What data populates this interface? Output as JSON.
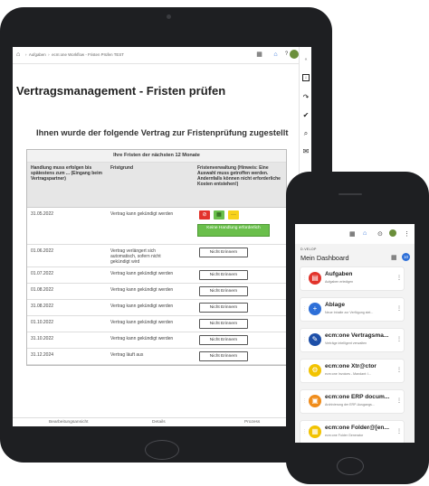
{
  "tablet": {
    "breadcrumb": [
      "Aufgaben",
      "ecm:one Workflow - Fristen Prüfen TEST"
    ],
    "title": "Vertragsmanagement - Fristen prüfen",
    "subtitle": "Ihnen wurde der folgende Vertrag zur Fristenprüfung zugestellt",
    "table": {
      "title": "Ihre Fristen der nächsten 12 Monate",
      "headers": [
        "Handlung muss erfolgen bis spätestens zum ... (Eingang beim Vertragspartner)",
        "Fristgrund",
        "Fristenverwaltung (Hinweis: Eine Auswahl muss getroffen werden. Andernfalls können nicht erforderliche Kosten entstehen!)"
      ],
      "first_row": {
        "date": "31.05.2022",
        "reason": "Vertrag kann gekündigt werden",
        "action_label": "Keine Handlung erforderlich"
      },
      "rows": [
        {
          "date": "01.06.2022",
          "reason": "Vertrag verlängert sich automatisch, sofern nicht gekündigt wird",
          "button": "Nicht Erinnern"
        },
        {
          "date": "01.07.2022",
          "reason": "Vertrag kann gekündigt werden",
          "button": "Nicht Erinnern"
        },
        {
          "date": "01.08.2022",
          "reason": "Vertrag kann gekündigt werden",
          "button": "Nicht Erinnern"
        },
        {
          "date": "31.08.2022",
          "reason": "Vertrag kann gekündigt werden",
          "button": "Nicht Erinnern"
        },
        {
          "date": "01.10.2022",
          "reason": "Vertrag kann gekündigt werden",
          "button": "Nicht Erinnern"
        },
        {
          "date": "31.10.2022",
          "reason": "Vertrag kann gekündigt werden",
          "button": "Nicht Erinnern"
        },
        {
          "date": "31.12.2024",
          "reason": "Vertrag läuft aus",
          "button": "Nicht Erinnern"
        }
      ]
    },
    "bottom_tabs": [
      "Bearbeitungsansicht",
      "Details",
      "Prozess"
    ]
  },
  "phone": {
    "brand": "D.VELOP",
    "dashboard_title": "Mein Dashboard",
    "badge_count": "10",
    "cards": [
      {
        "title": "Aufgaben",
        "subtitle": "Aufgaben erledigen",
        "color": "#e2332b",
        "icon": "tasks-icon",
        "glyph": "▤"
      },
      {
        "title": "Ablage",
        "subtitle": "Neue Inhalte zur Verfügung stel...",
        "color": "#2d6fd8",
        "icon": "add-icon",
        "glyph": "+"
      },
      {
        "title": "ecm:one Vertragsma...",
        "subtitle": "Verträge intelligent verwalten",
        "color": "#1d4fa8",
        "icon": "contract-icon",
        "glyph": "✎"
      },
      {
        "title": "ecm:one Xtr@ctor",
        "subtitle": "ecm:one Invoices - Mandant: I...",
        "color": "#f2c300",
        "icon": "extractor-icon",
        "glyph": "⚙"
      },
      {
        "title": "ecm:one ERP docum...",
        "subtitle": "Archivierung der ERP-Ausgangs...",
        "color": "#f08c1a",
        "icon": "erp-icon",
        "glyph": "▣"
      },
      {
        "title": "ecm:one Folder@[en...",
        "subtitle": "ecm:one Folder Generator",
        "color": "#f2c300",
        "icon": "folder-icon",
        "glyph": "▦"
      }
    ]
  }
}
